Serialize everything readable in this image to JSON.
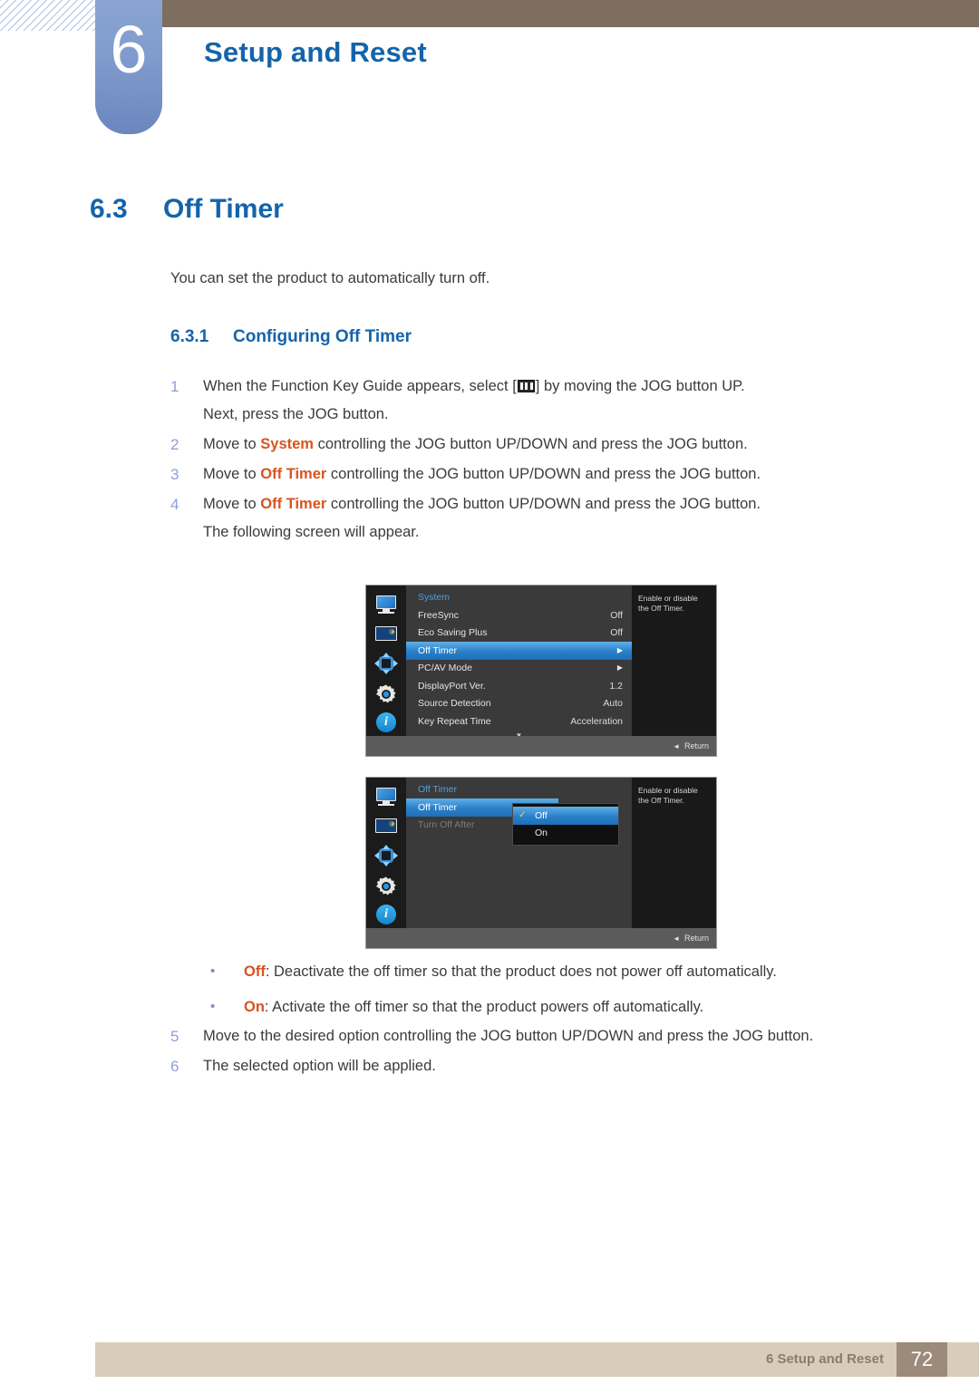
{
  "chapter": {
    "number": "6",
    "title": "Setup and Reset"
  },
  "section": {
    "number": "6.3",
    "title": "Off Timer",
    "intro": "You can set the product to automatically turn off."
  },
  "subsection": {
    "number": "6.3.1",
    "title": "Configuring Off Timer"
  },
  "steps": [
    {
      "n": "1",
      "line1_a": "When the Function Key Guide appears, select [",
      "line1_icon": "menu-icon",
      "line1_b": "] by moving the JOG button UP.",
      "line2": "Next, press the JOG button."
    },
    {
      "n": "2",
      "pre": "Move to ",
      "kw": "System",
      "post": " controlling the JOG button UP/DOWN and press the JOG button."
    },
    {
      "n": "3",
      "pre": "Move to ",
      "kw": "Off Timer",
      "post": " controlling the JOG button UP/DOWN and press the JOG button."
    },
    {
      "n": "4",
      "pre": "Move to ",
      "kw": "Off Timer",
      "post": " controlling the JOG button UP/DOWN and press the JOG button.",
      "line2": "The following screen will appear."
    }
  ],
  "bullets": [
    {
      "marker": "•",
      "kw": "Off",
      "text": ": Deactivate the off timer so that the product does not power off automatically."
    },
    {
      "marker": "•",
      "kw": "On",
      "text": ": Activate the off timer so that the product powers off automatically."
    }
  ],
  "steps2": [
    {
      "n": "5",
      "text": "Move to the desired option controlling the JOG button UP/DOWN and press the JOG button."
    },
    {
      "n": "6",
      "text": "The selected option will be applied."
    }
  ],
  "osd1": {
    "title": "System",
    "sidebar_icons": [
      "monitor-icon",
      "picture-color-icon",
      "four-way-arrows-icon",
      "gear-icon",
      "info-icon"
    ],
    "rows": [
      {
        "label": "FreeSync",
        "value": "Off",
        "selected": false,
        "arrow": false
      },
      {
        "label": "Eco Saving Plus",
        "value": "Off",
        "selected": false,
        "arrow": false
      },
      {
        "label": "Off Timer",
        "value": "",
        "selected": true,
        "arrow": true
      },
      {
        "label": "PC/AV Mode",
        "value": "",
        "selected": false,
        "arrow": true
      },
      {
        "label": "DisplayPort Ver.",
        "value": "1.2",
        "selected": false,
        "arrow": false
      },
      {
        "label": "Source Detection",
        "value": "Auto",
        "selected": false,
        "arrow": false
      },
      {
        "label": "Key Repeat Time",
        "value": "Acceleration",
        "selected": false,
        "arrow": false
      }
    ],
    "scroll_indicator": "▼",
    "help": "Enable or disable the Off Timer.",
    "return_label": "Return",
    "return_icon": "◄"
  },
  "osd2": {
    "title": "Off Timer",
    "sidebar_icons": [
      "monitor-icon",
      "picture-color-icon",
      "four-way-arrows-icon",
      "gear-icon",
      "info-icon"
    ],
    "rows": [
      {
        "label": "Off Timer",
        "selected": true,
        "dim": false
      },
      {
        "label": "Turn Off After",
        "selected": false,
        "dim": true
      }
    ],
    "popup": {
      "options": [
        {
          "label": "Off",
          "checked": true,
          "selected": true
        },
        {
          "label": "On",
          "checked": false,
          "selected": false
        }
      ],
      "check_glyph": "✓"
    },
    "help": "Enable or disable the Off Timer.",
    "return_label": "Return",
    "return_icon": "◄"
  },
  "footer": {
    "text": "6 Setup and Reset",
    "page": "72"
  },
  "colors": {
    "heading_blue": "#1464aa",
    "keyword_orange": "#d9531e",
    "step_number_blue": "#8e9fd8",
    "chapter_tag": "#7f9bcd",
    "top_bar_brown": "#7d6e5f",
    "footer_tan": "#d9cdba",
    "page_box_brown": "#9c8a7a"
  }
}
